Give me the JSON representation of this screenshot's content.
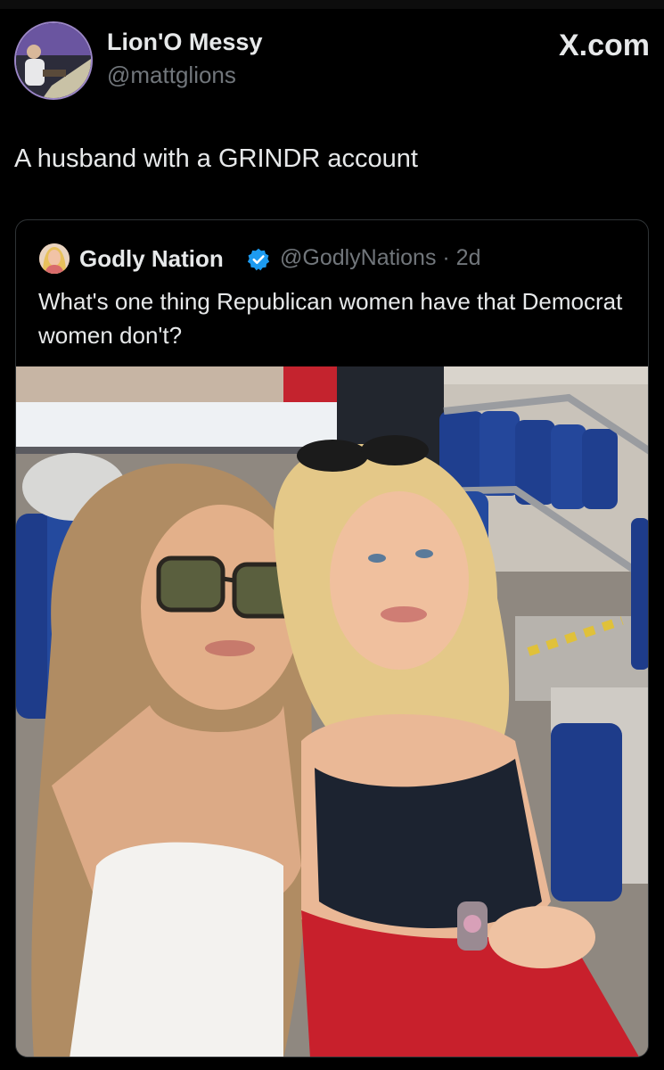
{
  "tweet": {
    "author": {
      "display_name": "Lion'O Messy",
      "handle": "@mattglions",
      "avatar": "avatar-photo"
    },
    "brand_label": "X.com",
    "text": "A husband with a GRINDR account"
  },
  "quoted_tweet": {
    "author": {
      "display_name": "Godly Nation",
      "verified": true,
      "handle_meta": "@GodlyNations · 2d",
      "avatar": "avatar-photo"
    },
    "text": "What's one thing Republican women have that Democrat women don't?",
    "media": {
      "type": "photo",
      "icon": "photo-image"
    }
  },
  "colors": {
    "background": "#000000",
    "primary_text": "#e7e9ea",
    "secondary_text": "#71767b",
    "border": "#2f3336",
    "verified_badge": "#1d9bf0"
  }
}
